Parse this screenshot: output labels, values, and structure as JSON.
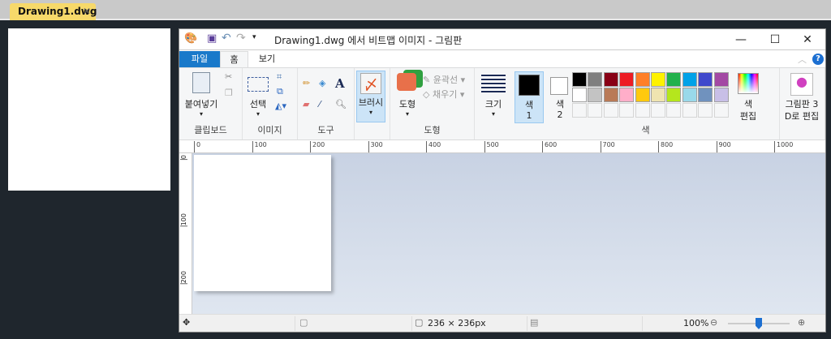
{
  "doc_tab": {
    "label": "Drawing1.dwg",
    "close": "✕"
  },
  "window": {
    "title": "Drawing1.dwg 에서 비트맵 이미지 - 그림판",
    "minimize": "—",
    "maximize": "☐",
    "close": "✕"
  },
  "tabs": [
    {
      "label": "파일"
    },
    {
      "label": "홈"
    },
    {
      "label": "보기"
    }
  ],
  "ribbon": {
    "clipboard": {
      "paste": "붙여넣기",
      "group": "클립보드"
    },
    "image": {
      "select": "선택",
      "group": "이미지"
    },
    "tools": {
      "group": "도구"
    },
    "brush": {
      "label": "브러시"
    },
    "shapes": {
      "shapes": "도형",
      "outline": "윤곽선",
      "fill": "채우기",
      "group": "도형"
    },
    "size": {
      "label": "크기"
    },
    "colors": {
      "color1": "색",
      "color1_num": "1",
      "color2": "색",
      "color2_num": "2",
      "edit": "색",
      "edit2": "편집",
      "group": "색",
      "palette": [
        "#000000",
        "#7f7f7f",
        "#880015",
        "#ed1c24",
        "#ff7f27",
        "#fff200",
        "#22b14c",
        "#00a2e8",
        "#3f48cc",
        "#a349a4",
        "#ffffff",
        "#c3c3c3",
        "#b97a57",
        "#ffaec9",
        "#ffc90e",
        "#efe4b0",
        "#b5e61d",
        "#99d9ea",
        "#7092be",
        "#c8bfe7"
      ],
      "primary": "#000000",
      "secondary": "#ffffff"
    },
    "paint3d": {
      "line1": "그림판 3",
      "line2": "D로 편집"
    }
  },
  "ruler": {
    "h": [
      "0",
      "100",
      "200",
      "300",
      "400",
      "500",
      "600",
      "700",
      "800",
      "900",
      "1000"
    ],
    "v": [
      "0",
      "100",
      "200"
    ]
  },
  "status": {
    "dimensions": "236 × 236px",
    "zoom": "100%",
    "zoom_level": 0.5
  }
}
